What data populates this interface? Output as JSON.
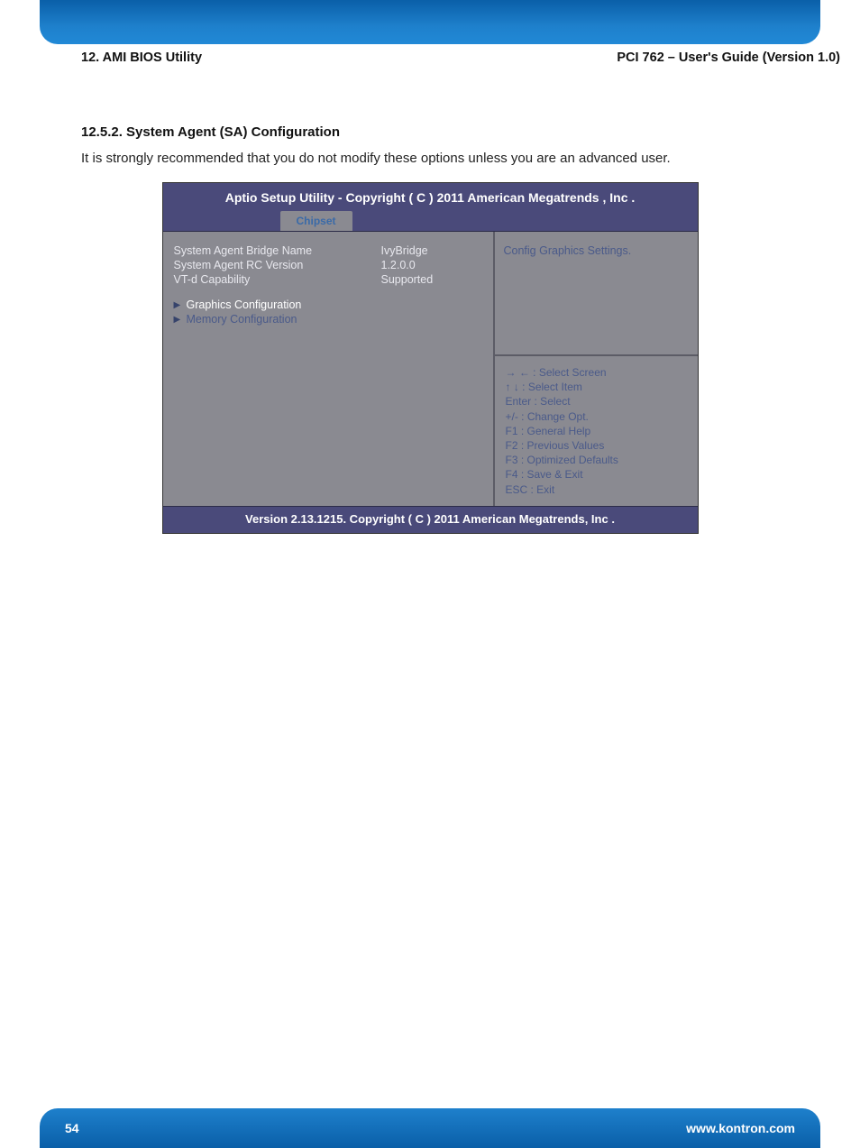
{
  "header": {
    "left": "12. AMI BIOS Utility",
    "right": "PCI 762 – User's Guide (Version 1.0)"
  },
  "section": {
    "heading": "12.5.2. System Agent (SA) Configuration",
    "body": "It is strongly recommended that you do not modify these options unless you are an advanced user."
  },
  "bios": {
    "title": "Aptio Setup Utility - Copyright ( C ) 2011 American Megatrends , Inc .",
    "tab": "Chipset",
    "info": [
      {
        "label": "System Agent Bridge Name",
        "value": "IvyBridge"
      },
      {
        "label": "System Agent RC Version",
        "value": "1.2.0.0"
      },
      {
        "label": "VT-d Capability",
        "value": "Supported"
      }
    ],
    "submenu": [
      {
        "label": "Graphics Configuration",
        "selected": true
      },
      {
        "label": "Memory  Configuration",
        "selected": false
      }
    ],
    "help_top": "Config Graphics Settings.",
    "help_lines": [
      "→ ← : Select Screen",
      "↑ ↓   : Select Item",
      "Enter  :  Select",
      "+/- :   Change Opt.",
      "F1 :   General Help",
      "F2 :   Previous Values",
      "F3 :   Optimized Defaults",
      "F4 :   Save & Exit",
      "ESC :  Exit"
    ],
    "footer": "Version 2.13.1215. Copyright ( C ) 2011 American Megatrends, Inc ."
  },
  "footer": {
    "page": "54",
    "url": "www.kontron.com"
  }
}
